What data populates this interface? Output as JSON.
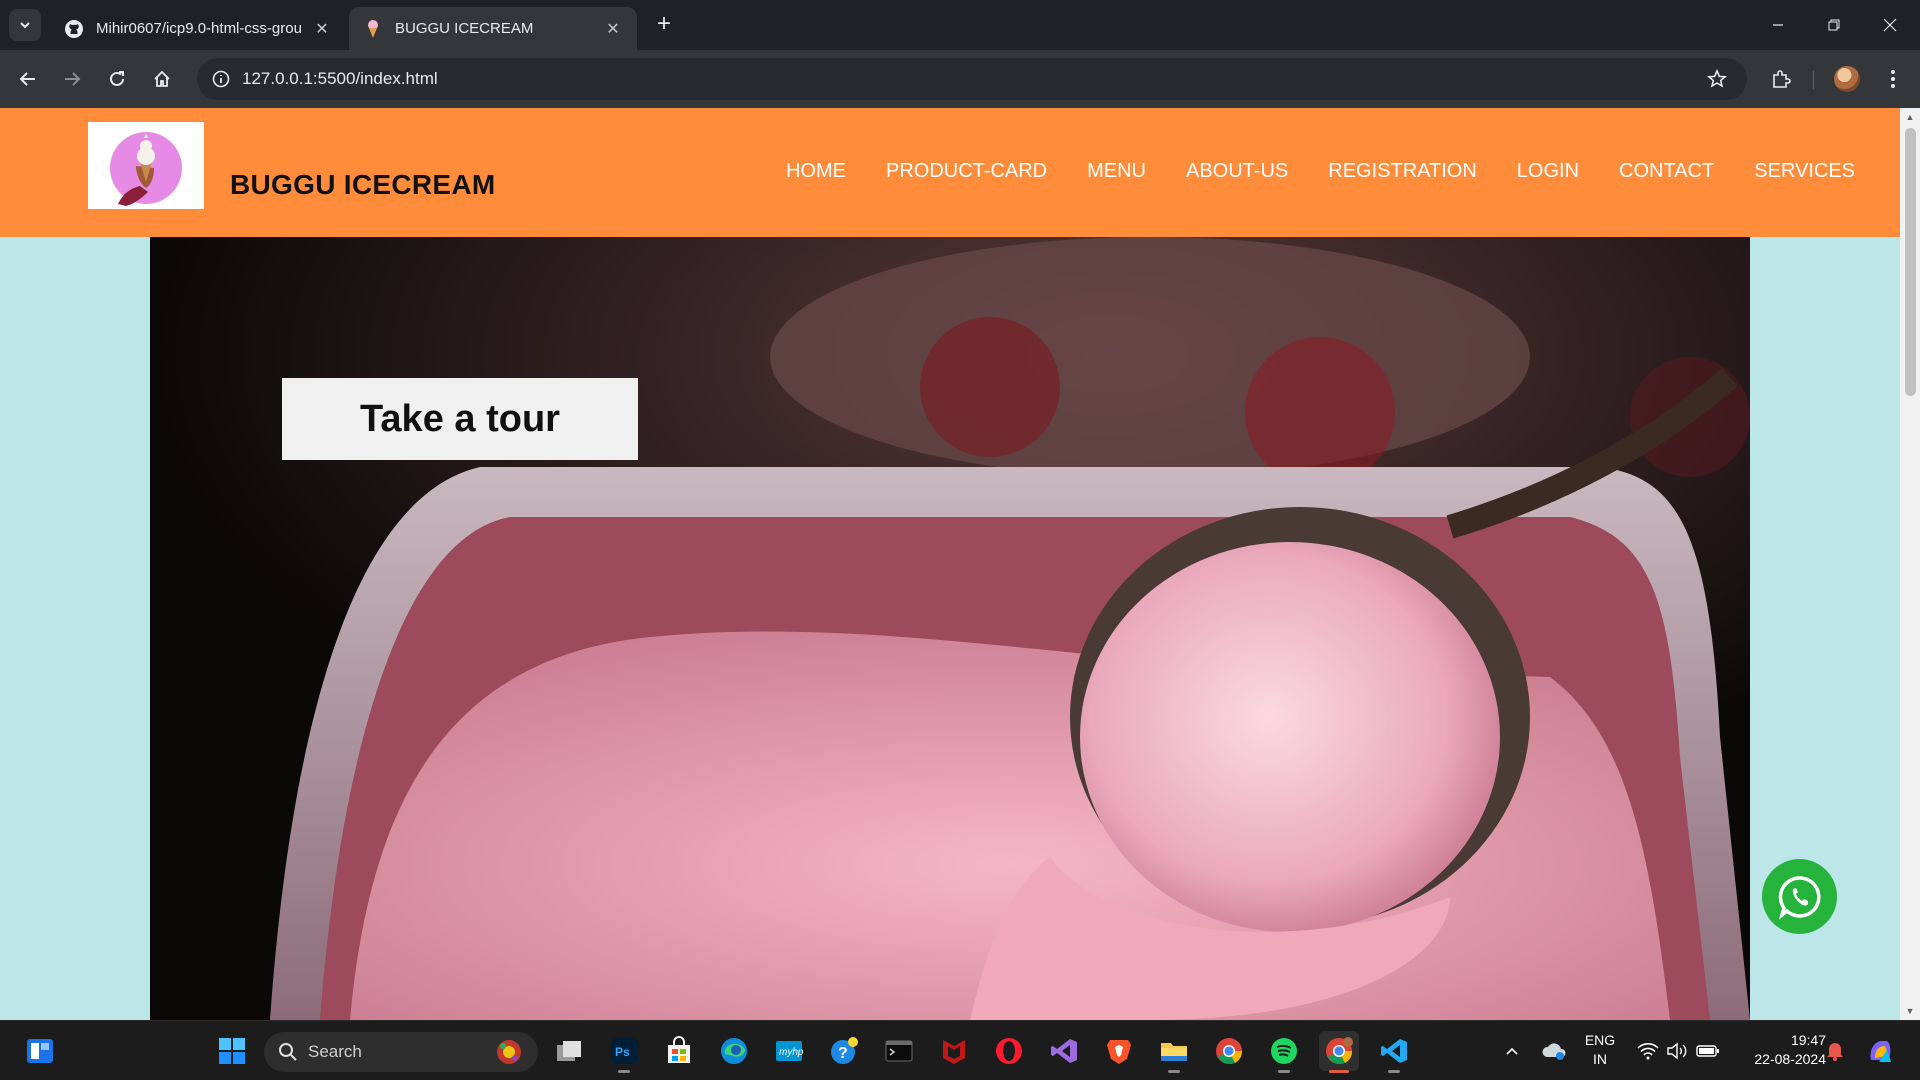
{
  "browser": {
    "tabs": [
      {
        "title": "Mihir0607/icp9.0-html-css-grou",
        "favicon": "github-icon",
        "active": false
      },
      {
        "title": "BUGGU ICECREAM",
        "favicon": "ice-cream-icon",
        "active": true
      }
    ],
    "url": "127.0.0.1:5500/index.html"
  },
  "site": {
    "brand": "BUGGU ICECREAM",
    "nav": [
      "HOME",
      "PRODUCT-CARD",
      "MENU",
      "ABOUT-US",
      "REGISTRATION",
      "LOGIN",
      "CONTACT",
      "SERVICES"
    ],
    "hero_button": "Take a tour",
    "colors": {
      "header": "#ff8c3a",
      "page_bg": "#bce6e8",
      "whatsapp": "#25b33b"
    }
  },
  "taskbar": {
    "search_label": "Search",
    "apps": [
      "widgets-icon",
      "start-icon",
      "task-view-icon",
      "photoshop-icon",
      "store-icon",
      "edge-icon",
      "myhp-icon",
      "help-icon",
      "terminal-icon",
      "mcafee-icon",
      "opera-icon",
      "visual-studio-icon",
      "brave-icon",
      "file-explorer-icon",
      "chrome-icon",
      "spotify-icon",
      "chrome-profile-icon",
      "vscode-icon"
    ],
    "language": "ENG",
    "region": "IN",
    "time": "19:47",
    "date": "22-08-2024"
  }
}
